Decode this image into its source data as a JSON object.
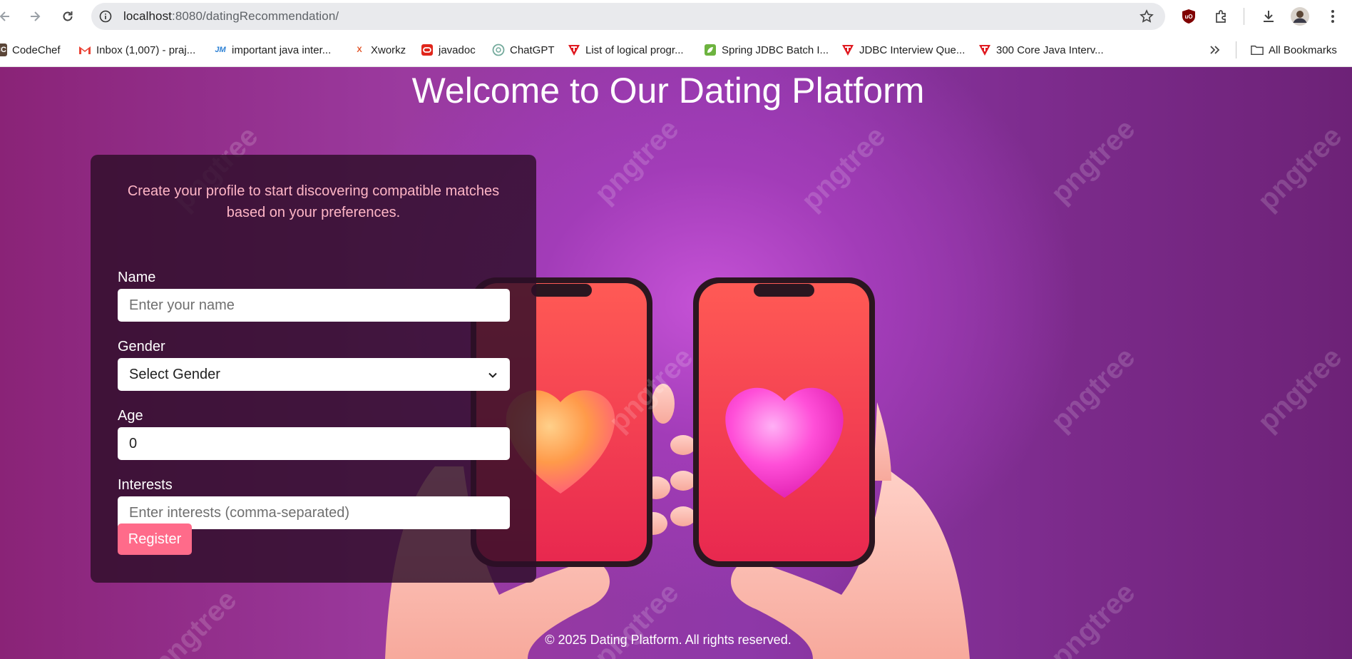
{
  "browser": {
    "url_host": "localhost",
    "url_rest": ":8080/datingRecommendation/",
    "bookmarks": [
      {
        "label": "CodeChef",
        "icon": "codechef-icon"
      },
      {
        "label": "Inbox (1,007) - praj...",
        "icon": "gmail-icon"
      },
      {
        "label": "important java inter...",
        "icon": "jmse-icon"
      },
      {
        "label": "Xworkz",
        "icon": "xworkz-icon"
      },
      {
        "label": "javadoc",
        "icon": "oracle-icon"
      },
      {
        "label": "ChatGPT",
        "icon": "chatgpt-icon"
      },
      {
        "label": "List of logical progr...",
        "icon": "javatpoint-icon"
      },
      {
        "label": "Spring JDBC Batch I...",
        "icon": "spring-icon"
      },
      {
        "label": "JDBC Interview Que...",
        "icon": "javatpoint-icon"
      },
      {
        "label": "300 Core Java Interv...",
        "icon": "javatpoint-icon"
      }
    ],
    "all_bookmarks_label": "All Bookmarks"
  },
  "page": {
    "title": "Welcome to Our Dating Platform",
    "intro": "Create your profile to start discovering compatible matches based on your preferences.",
    "form": {
      "name_label": "Name",
      "name_placeholder": "Enter your name",
      "gender_label": "Gender",
      "gender_selected": "Select Gender",
      "age_label": "Age",
      "age_value": "0",
      "interests_label": "Interests",
      "interests_placeholder": "Enter interests (comma-separated)",
      "register_label": "Register"
    },
    "footer": "© 2025 Dating Platform. All rights reserved.",
    "watermark": "pngtree"
  },
  "colors": {
    "accent_button": "#ff6b8a",
    "intro_text": "#ffb6c6",
    "heart_right": "#ff4fd8",
    "heart_left": "#ff9a4a"
  }
}
